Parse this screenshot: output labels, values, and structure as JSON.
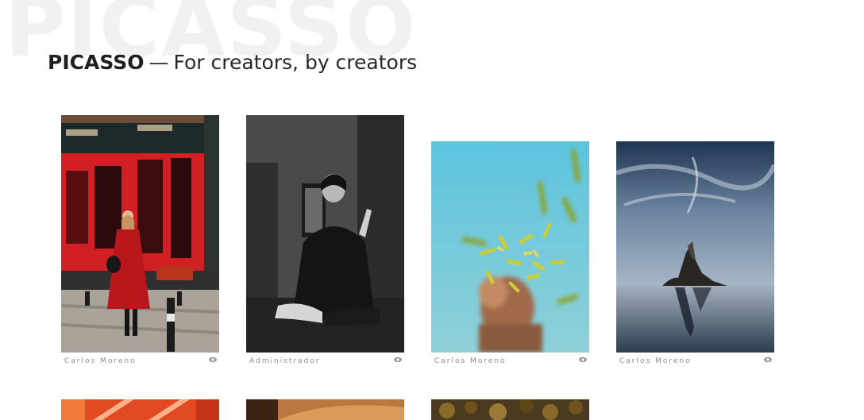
{
  "site": {
    "watermark": "PICASSO",
    "brand": "PICASSO",
    "separator": "—",
    "tagline": "For creators, by creators"
  },
  "gallery": [
    {
      "author": "Carlos Moreno",
      "icon": "eye-icon",
      "subject": "woman in red coat in front of red cafe storefront"
    },
    {
      "author": "Administrador",
      "icon": "eye-icon",
      "subject": "black and white portrait of woman smoking"
    },
    {
      "author": "Carlos Moreno",
      "icon": "eye-icon",
      "subject": "blurred yellow confetti against blue sky"
    },
    {
      "author": "Carlos Moreno",
      "icon": "eye-icon",
      "subject": "rock formation in calm sea under cloudy sky"
    }
  ],
  "colors": {
    "accent_red": "#d21f23",
    "meta_text": "#8a8a8a",
    "sky_blue": "#4fbcd7"
  }
}
